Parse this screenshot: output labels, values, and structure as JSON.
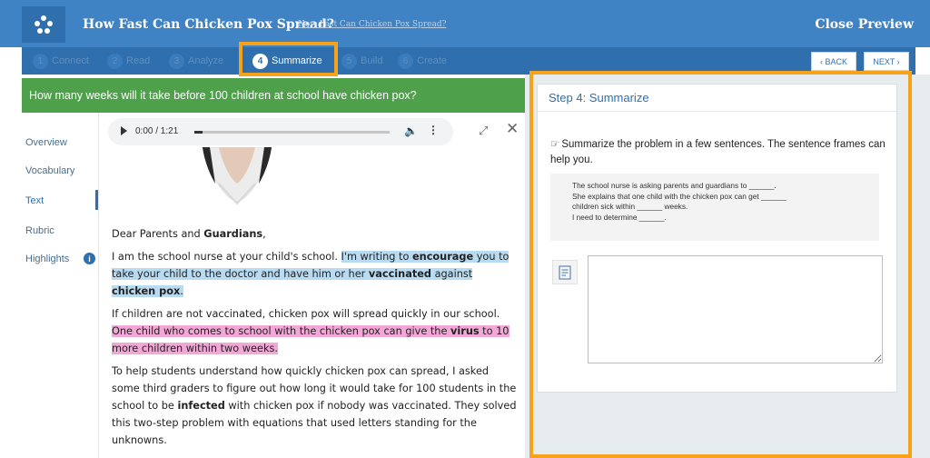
{
  "header": {
    "title": "How Fast Can Chicken Pox Spread?",
    "subtitle": "How Fast Can Chicken Pox Spread?",
    "close_label": "Close Preview",
    "brand_color": "#3f83c4"
  },
  "steps": [
    {
      "num": "1",
      "label": "Connect"
    },
    {
      "num": "2",
      "label": "Read"
    },
    {
      "num": "3",
      "label": "Analyze"
    },
    {
      "num": "4",
      "label": "Summarize"
    },
    {
      "num": "5",
      "label": "Build"
    },
    {
      "num": "6",
      "label": "Create"
    }
  ],
  "active_step": 4,
  "nav": {
    "back": "‹ BACK",
    "next": "NEXT ›"
  },
  "question": "How many weeks will it take before 100 children at school have chicken pox?",
  "sidebar": {
    "items": [
      {
        "label": "Overview"
      },
      {
        "label": "Vocabulary"
      },
      {
        "label": "Text"
      },
      {
        "label": "Rubric"
      },
      {
        "label": "Highlights"
      }
    ],
    "active": "Text"
  },
  "audio": {
    "time": "0:00 / 1:21",
    "progress": 0.0
  },
  "letter": {
    "greeting_a": "Dear Parents and ",
    "greeting_b": "Guardians",
    "greeting_c": ",",
    "p1_a": "I am the school nurse at your child's school. ",
    "p1_h1": "I'm writing to ",
    "p1_h2": "encourage",
    "p1_h3": " you to take your child to the doctor and have him or her ",
    "p1_h4": "vaccinated",
    "p1_h5": " against ",
    "p1_h6": "chicken pox",
    "p1_h7": ".",
    "p2_a": "If children are not vaccinated, chicken pox will spread quickly in our school. ",
    "p2_h1": "One child who comes to school with the chicken pox can give the ",
    "p2_h2": "virus",
    "p2_h3": " to 10 more children within two weeks.",
    "p3_a": "To help students understand how quickly chicken pox can spread, I asked some third graders to figure out how long it would take for 100 students in the school to be ",
    "p3_b": "infected",
    "p3_c": " with chicken pox if nobody was vaccinated. They solved this two-step problem with equations that used letters standing for the unknowns."
  },
  "highlight_colors": {
    "blue": "#b9dbf2",
    "pink": "#f2a7d7",
    "frame": "#f4a31a"
  },
  "panel": {
    "title": "Step 4: Summarize",
    "instruction": "Summarize the problem in a few sentences. The sentence frames can help you.",
    "frames": [
      "The school nurse is asking parents and guardians to ______.",
      "She explains that one child with the chicken pox can get ______",
      "children sick within ______ weeks.",
      "I need to determine ______."
    ],
    "answer": ""
  }
}
